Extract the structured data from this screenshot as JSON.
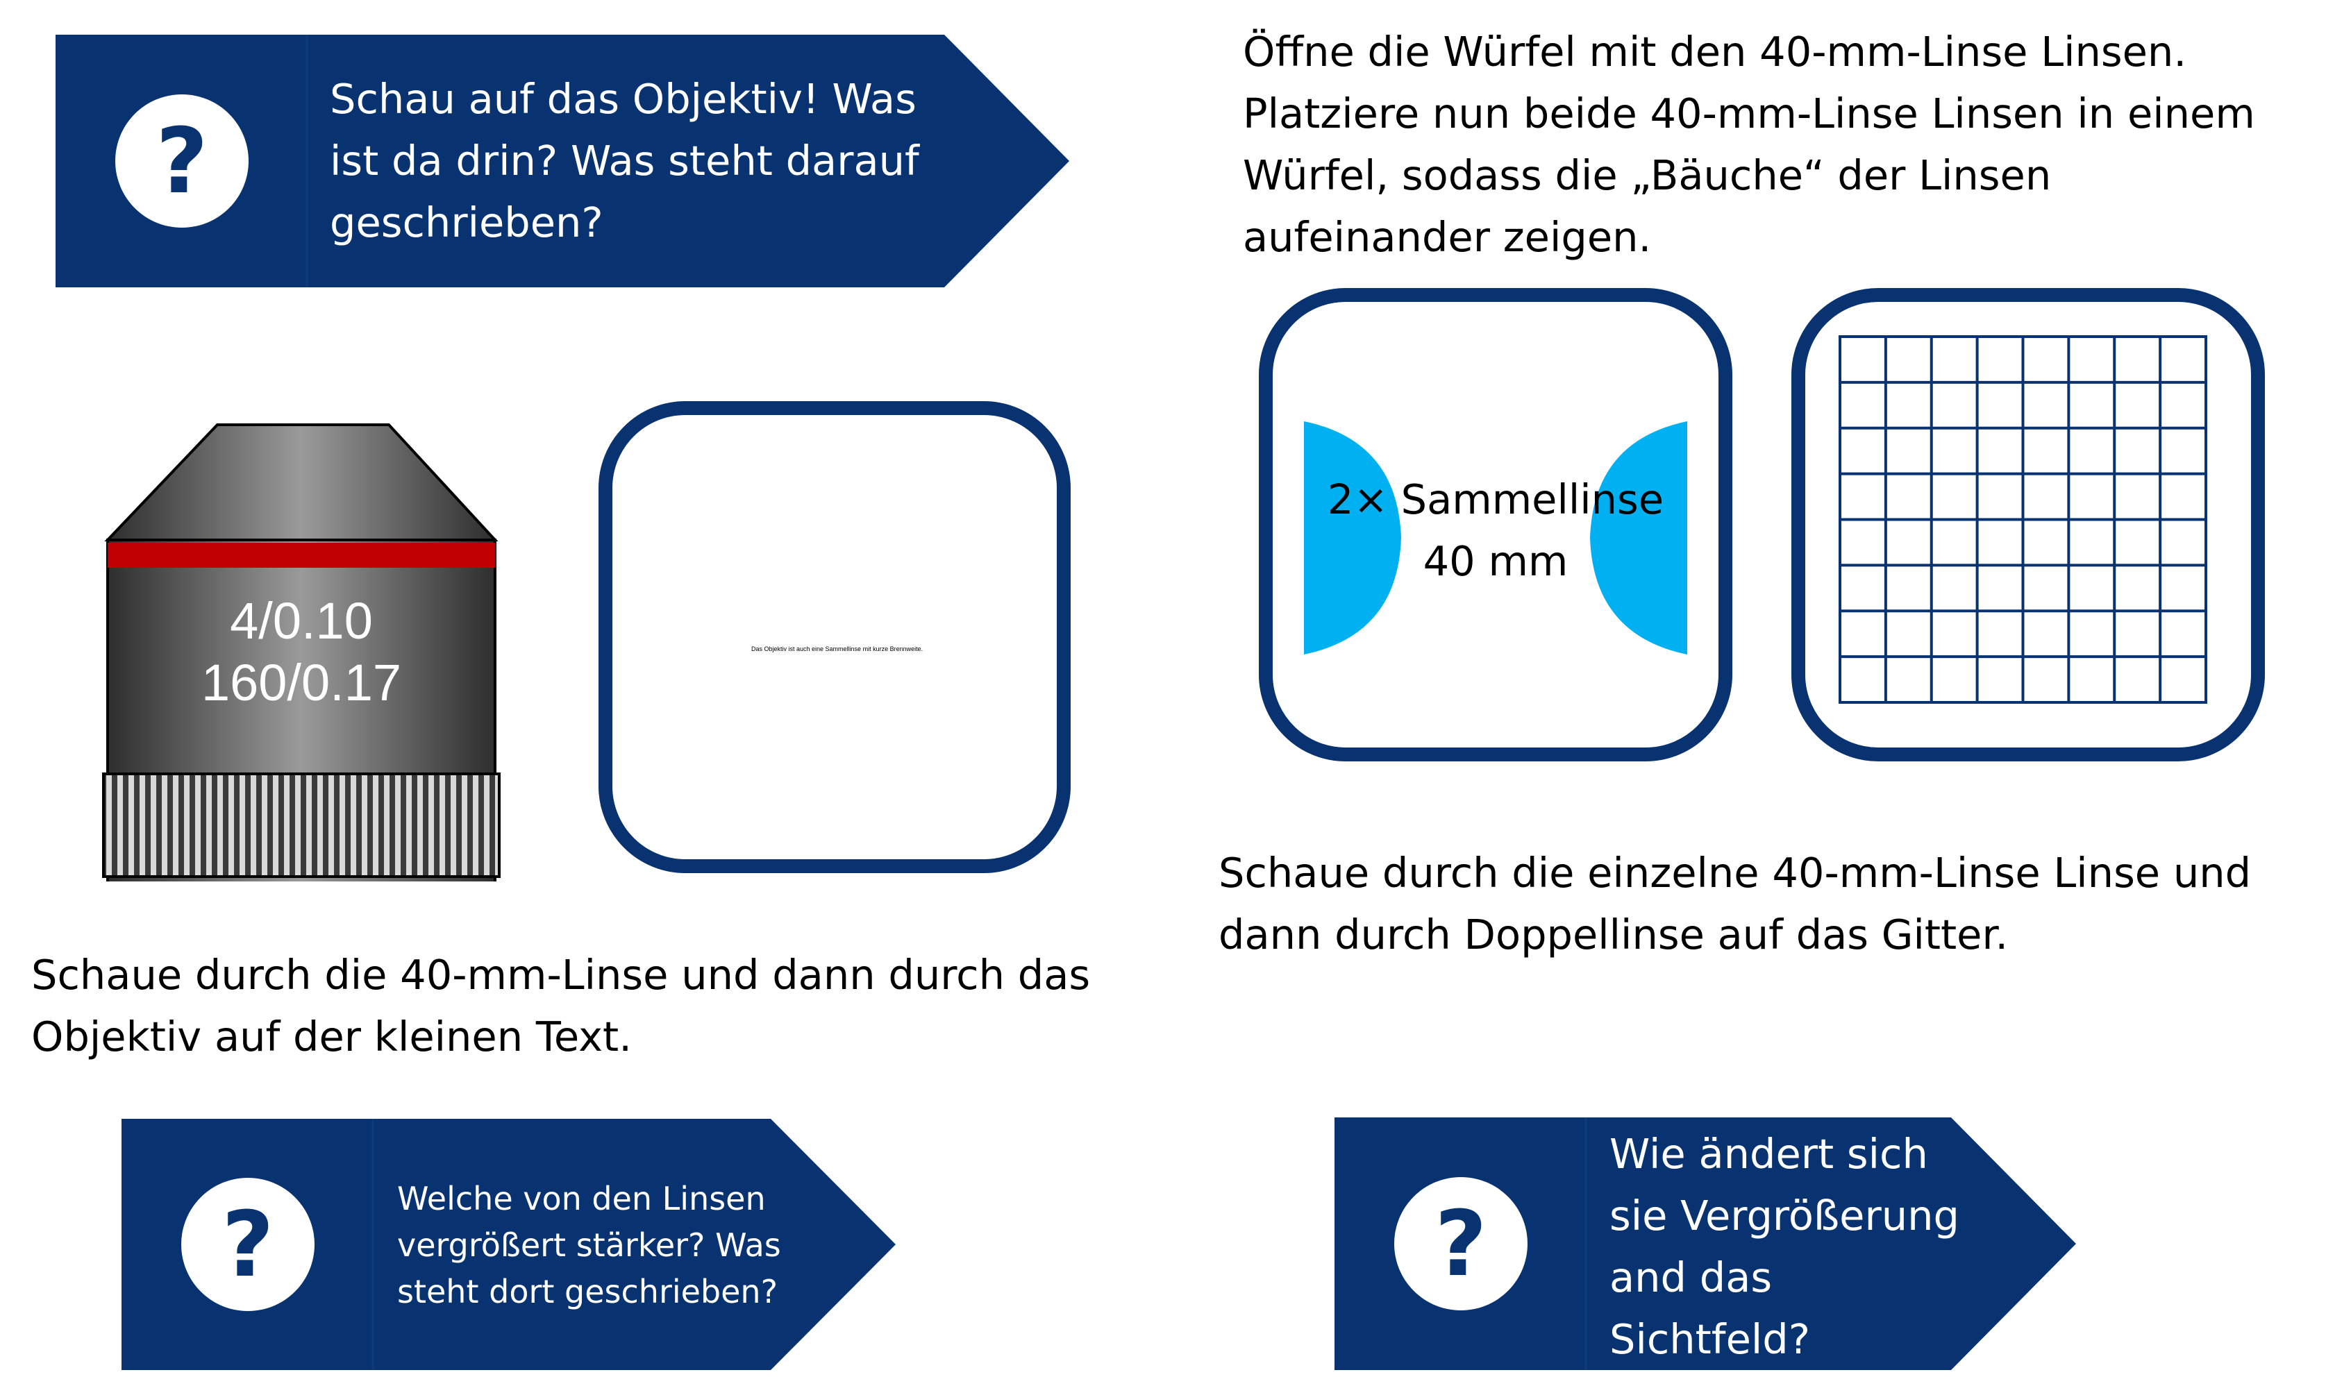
{
  "colors": {
    "navy": "#083370",
    "lens_blue": "#00B0F0",
    "red_band": "#C00000"
  },
  "banner_top_left": {
    "icon": "question-mark-icon",
    "text_lines": [
      "Schau auf das Objektiv! Was",
      "ist da drin? Was steht darauf",
      "geschrieben?"
    ]
  },
  "instruction_top_right": {
    "lines": [
      "Öffne die Würfel mit den 40-mm-Linse Linsen.",
      "Platziere nun beide 40-mm-Linse Linsen in einem",
      "Würfel, sodass die „Bäuche“ der Linsen",
      "aufeinander zeigen."
    ]
  },
  "objective": {
    "label_line1": "4/0.10",
    "label_line2": "160/0.17"
  },
  "small_text_cube": {
    "text": "Das Objektiv ist auch eine Sammellinse mit kurze Brennweite."
  },
  "lens_cube": {
    "label_line1": "2× Sammellinse",
    "label_line2": "40 mm"
  },
  "grid_cube": {
    "rows": 8,
    "cols": 8
  },
  "instruction_middle_right": {
    "lines": [
      "Schaue durch die einzelne 40-mm-Linse Linse und",
      "dann durch Doppellinse auf das Gitter."
    ]
  },
  "instruction_middle_left": {
    "lines": [
      "Schaue durch die 40-mm-Linse und dann durch das",
      "Objektiv auf der kleinen Text."
    ]
  },
  "banner_bottom_left": {
    "icon": "question-mark-icon",
    "text_lines": [
      "Welche von den Linsen",
      "vergrößert stärker? Was",
      "steht dort geschrieben?"
    ]
  },
  "banner_bottom_right": {
    "icon": "question-mark-icon",
    "text_lines": [
      "Wie ändert sich",
      "sie Vergrößerung",
      "and das",
      "Sichtfeld?"
    ]
  }
}
